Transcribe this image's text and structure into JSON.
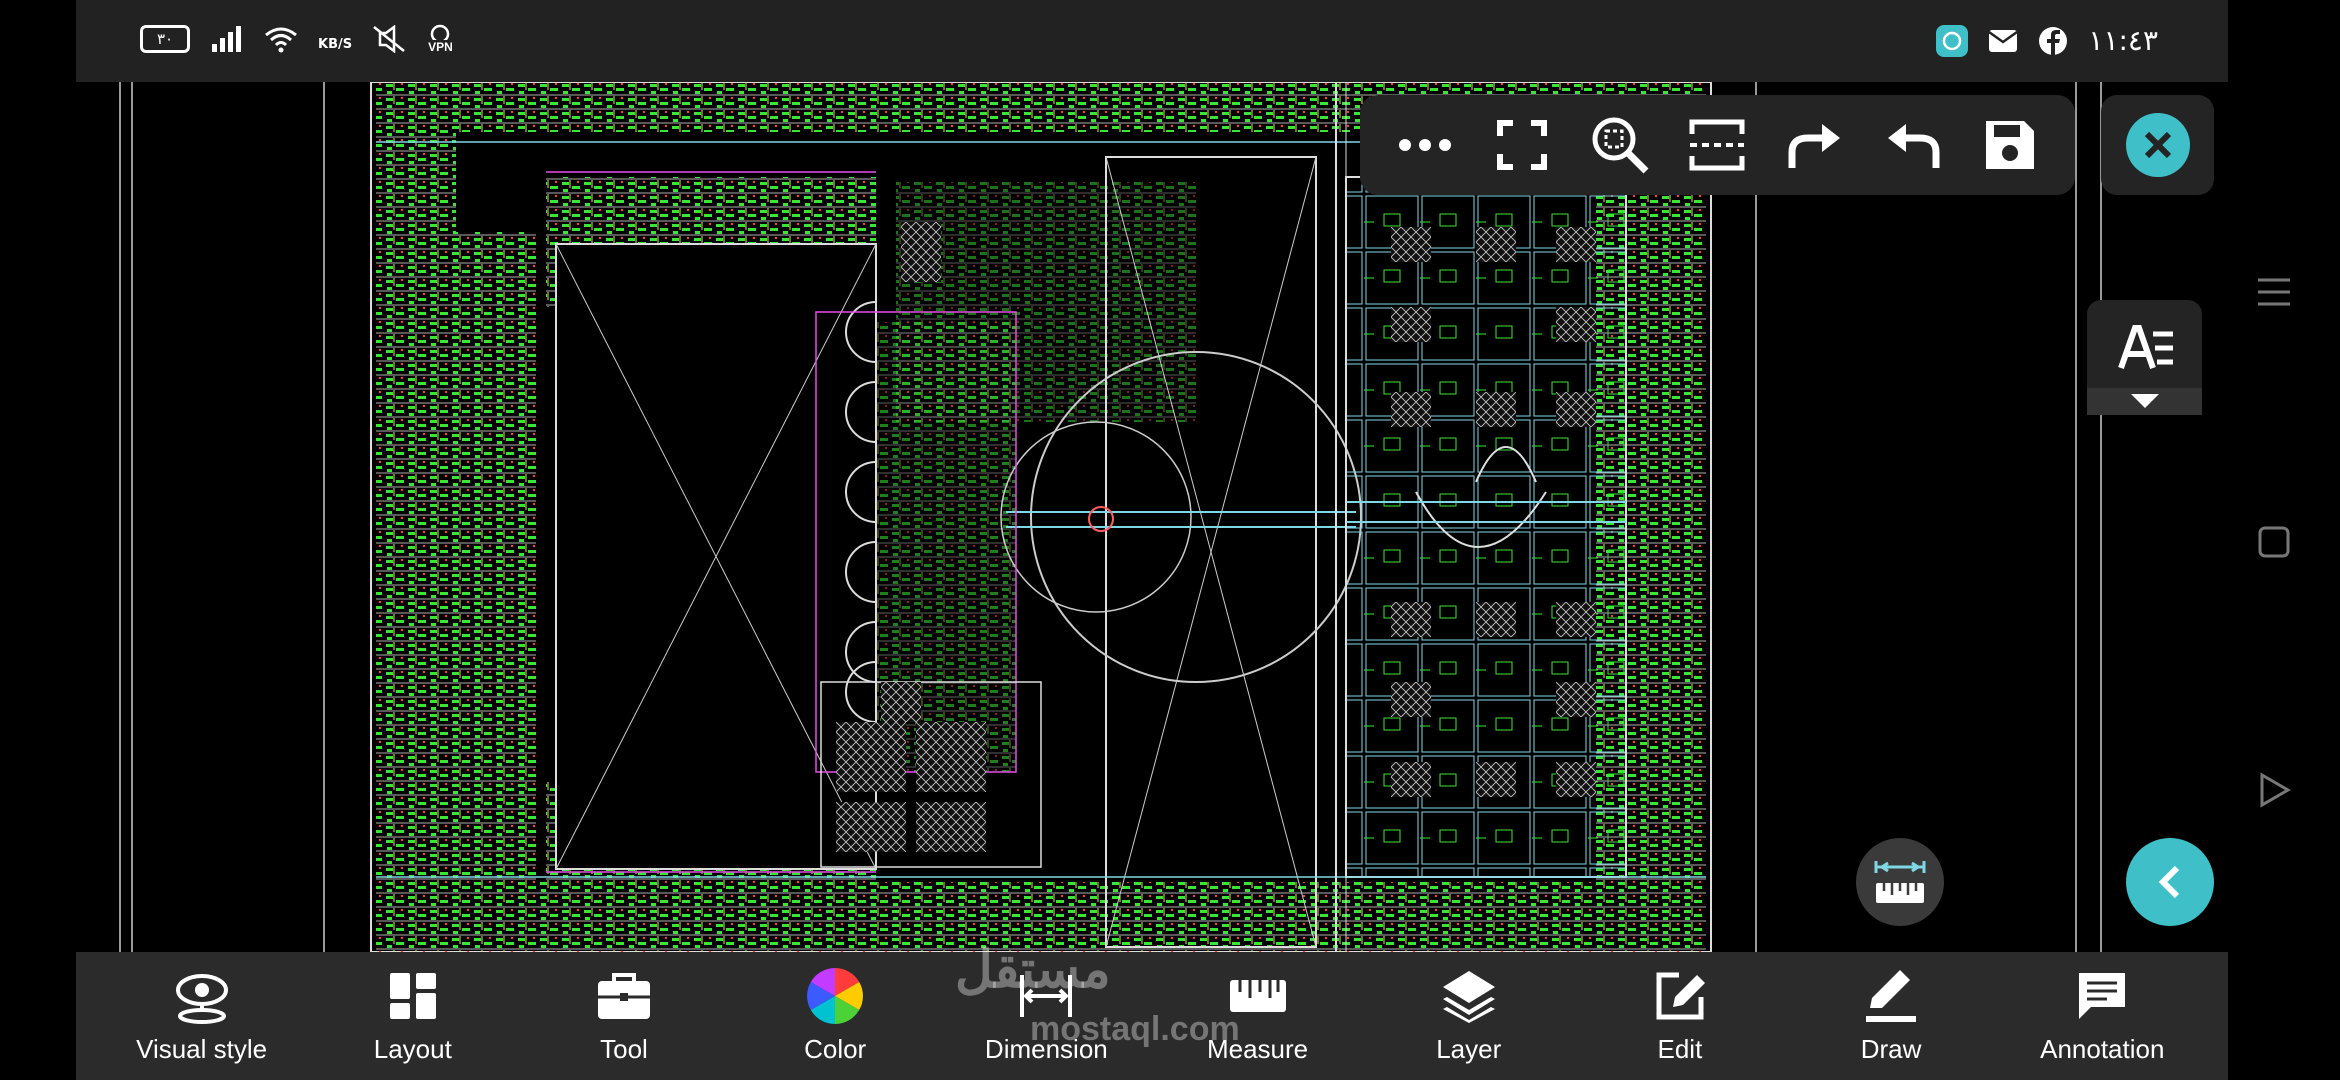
{
  "status_bar": {
    "battery": "٣٠",
    "network_speed": "KB/S",
    "vpn": "VPN",
    "clock": "١١:٤٣",
    "icons_left": [
      "battery-icon",
      "signal-icon",
      "wifi-icon",
      "mute-icon",
      "vpn-icon"
    ],
    "icons_right": [
      "whatsapp-icon",
      "mail-icon",
      "facebook-icon"
    ]
  },
  "toolbar": {
    "buttons": [
      "more-icon",
      "fullscreen-icon",
      "zoom-extents-icon",
      "screen-select-icon",
      "redo-icon",
      "undo-icon",
      "save-icon"
    ]
  },
  "text_panel": {
    "icon": "text-style-icon"
  },
  "bottom_nav": {
    "items": [
      {
        "label": "Visual style",
        "icon": "visual-style-icon"
      },
      {
        "label": "Layout",
        "icon": "layout-icon"
      },
      {
        "label": "Tool",
        "icon": "toolbox-icon"
      },
      {
        "label": "Color",
        "icon": "color-wheel-icon"
      },
      {
        "label": "Dimension",
        "icon": "dimension-icon"
      },
      {
        "label": "Measure",
        "icon": "ruler-icon"
      },
      {
        "label": "Layer",
        "icon": "layers-icon"
      },
      {
        "label": "Edit",
        "icon": "edit-icon"
      },
      {
        "label": "Draw",
        "icon": "pencil-icon"
      },
      {
        "label": "Annotation",
        "icon": "annotation-icon"
      }
    ]
  },
  "watermark": {
    "arabic": "مستقل",
    "latin": "mostaql.com"
  },
  "colors": {
    "accent": "#3fc0c8",
    "drawing_green": "#39e635",
    "drawing_cyan": "#7fd8e6",
    "panel": "#242424"
  }
}
